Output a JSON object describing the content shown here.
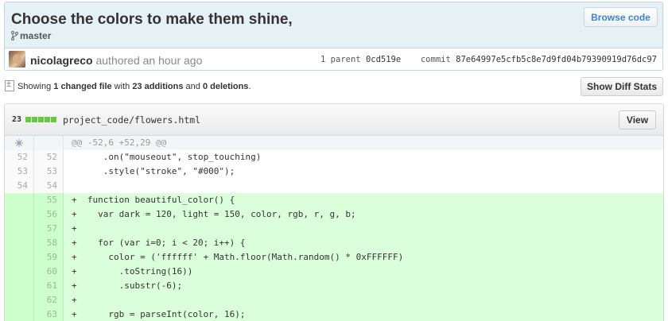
{
  "commit": {
    "title": "Choose the colors to make them shine,",
    "branch": "master",
    "browse_label": "Browse code",
    "author": "nicolagreco",
    "authored_text": "authored an hour ago",
    "parent_label": "1 parent",
    "parent_sha": "0cd519e",
    "commit_label": "commit",
    "commit_sha": "87e64997e5cfb5c8e7d9fd04b79390919d76dc97"
  },
  "toc": {
    "showing": "Showing ",
    "changed": "1 changed file",
    "with": " with ",
    "additions": "23 additions",
    "and": " and ",
    "deletions": "0 deletions",
    "period": ".",
    "diffstats_label": "Show Diff Stats"
  },
  "file": {
    "count": "23",
    "path": "project_code/flowers.html",
    "view_label": "View",
    "diffstat_color": "#6cc644"
  },
  "diff": {
    "hunk": "@@ -52,6 +52,29 @@",
    "lines": [
      {
        "old": "52",
        "new": "52",
        "type": "ctx",
        "text": "      .on(\"mouseout\", stop_touching)"
      },
      {
        "old": "53",
        "new": "53",
        "type": "ctx",
        "text": "      .style(\"stroke\", \"#000\");"
      },
      {
        "old": "54",
        "new": "54",
        "type": "ctx",
        "text": ""
      },
      {
        "old": "",
        "new": "55",
        "type": "add",
        "text": "+  function beautiful_color() {"
      },
      {
        "old": "",
        "new": "56",
        "type": "add",
        "text": "+    var dark = 120, light = 150, color, rgb, r, g, b;"
      },
      {
        "old": "",
        "new": "57",
        "type": "add",
        "text": "+"
      },
      {
        "old": "",
        "new": "58",
        "type": "add",
        "text": "+    for (var i=0; i < 20; i++) {"
      },
      {
        "old": "",
        "new": "59",
        "type": "add",
        "text": "+      color = ('ffffff' + Math.floor(Math.random() * 0xFFFFFF)"
      },
      {
        "old": "",
        "new": "60",
        "type": "add",
        "text": "+        .toString(16))"
      },
      {
        "old": "",
        "new": "61",
        "type": "add",
        "text": "+        .substr(-6);"
      },
      {
        "old": "",
        "new": "62",
        "type": "add",
        "text": "+"
      },
      {
        "old": "",
        "new": "63",
        "type": "add",
        "text": "+      rgb = parseInt(color, 16);"
      }
    ]
  }
}
